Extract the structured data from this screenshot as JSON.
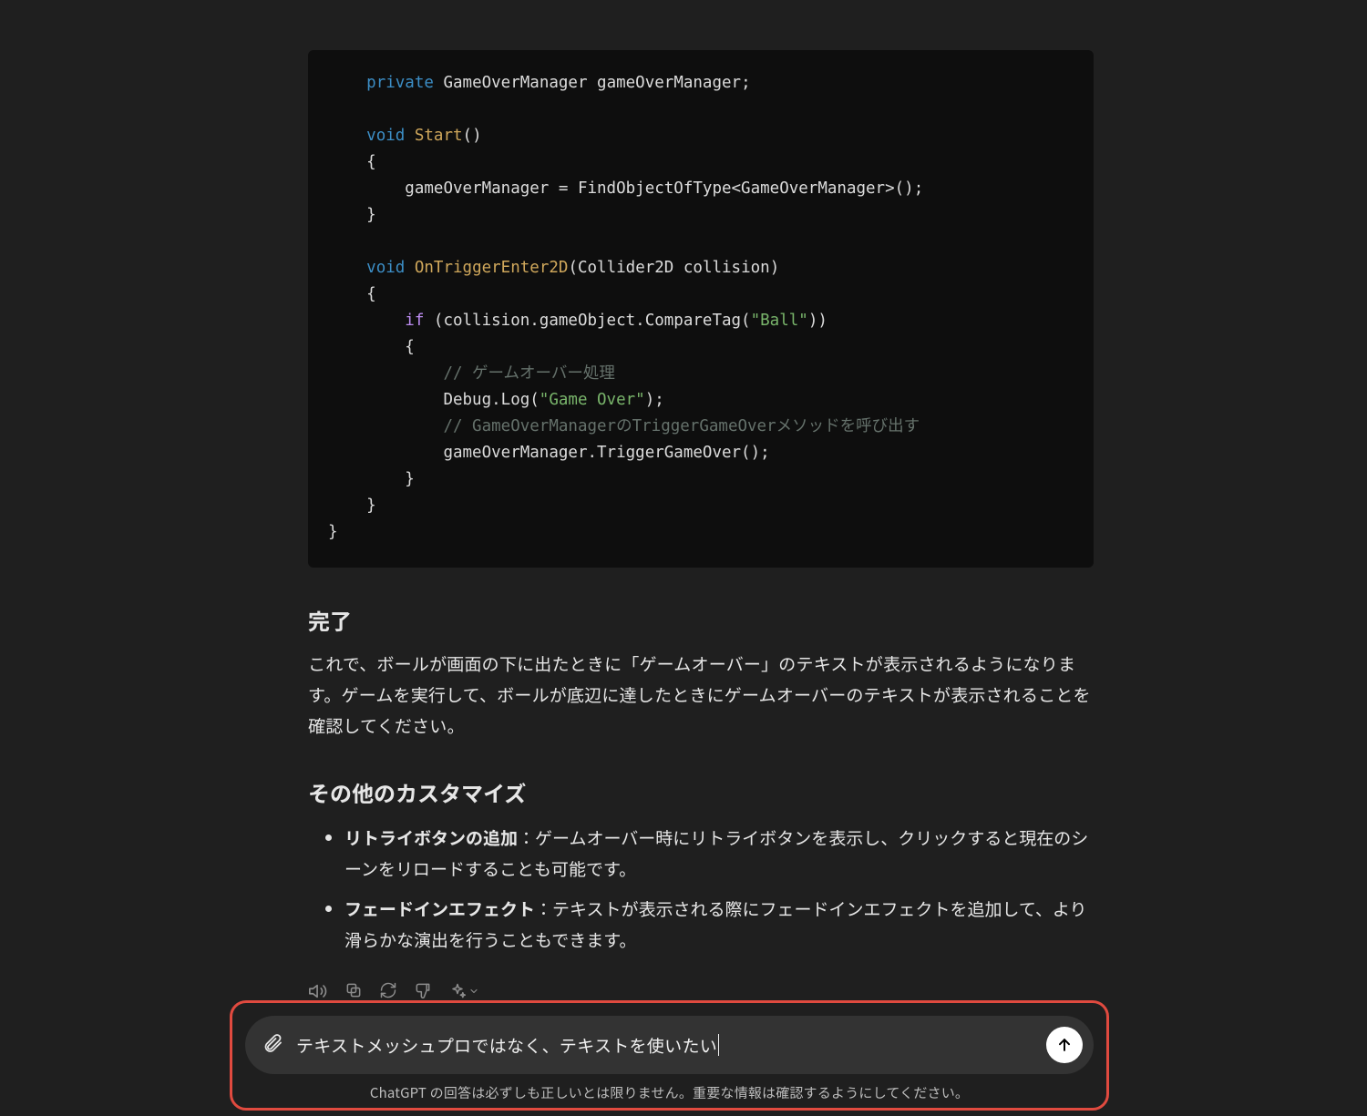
{
  "code": {
    "line1_kw": "private",
    "line1_rest": " GameOverManager gameOverManager;",
    "start_void": "void",
    "start_fn": " Start",
    "start_paren": "()",
    "start_body_assign": "gameOverManager = FindObjectOfType<GameOverManager>();",
    "trig_void": "void",
    "trig_fn": " OnTriggerEnter2D",
    "trig_args": "(Collider2D collision)",
    "if_kw": "if",
    "if_cond_pre": " (collision.gameObject.CompareTag(",
    "if_cond_str": "\"Ball\"",
    "if_cond_post": "))",
    "cm1": "// ゲームオーバー処理",
    "log_pre": "Debug.Log(",
    "log_str": "\"Game Over\"",
    "log_post": ");",
    "cm2": "// GameOverManagerのTriggerGameOverメソッドを呼び出す",
    "call": "gameOverManager.TriggerGameOver();"
  },
  "section1_title": "完了",
  "section1_body": "これで、ボールが画面の下に出たときに「ゲームオーバー」のテキストが表示されるようになります。ゲームを実行して、ボールが底辺に達したときにゲームオーバーのテキストが表示されることを確認してください。",
  "section2_title": "その他のカスタマイズ",
  "customize": [
    {
      "lead": "リトライボタンの追加",
      "rest": "：ゲームオーバー時にリトライボタンを表示し、クリックすると現在のシーンをリロードすることも可能です。"
    },
    {
      "lead": "フェードインエフェクト",
      "rest": "：テキストが表示される際にフェードインエフェクトを追加して、より滑らかな演出を行うこともできます。"
    }
  ],
  "composer": {
    "value": "テキストメッシュプロではなく、テキストを使いたい"
  },
  "disclaimer": "ChatGPT の回答は必ずしも正しいとは限りません。重要な情報は確認するようにしてください。"
}
